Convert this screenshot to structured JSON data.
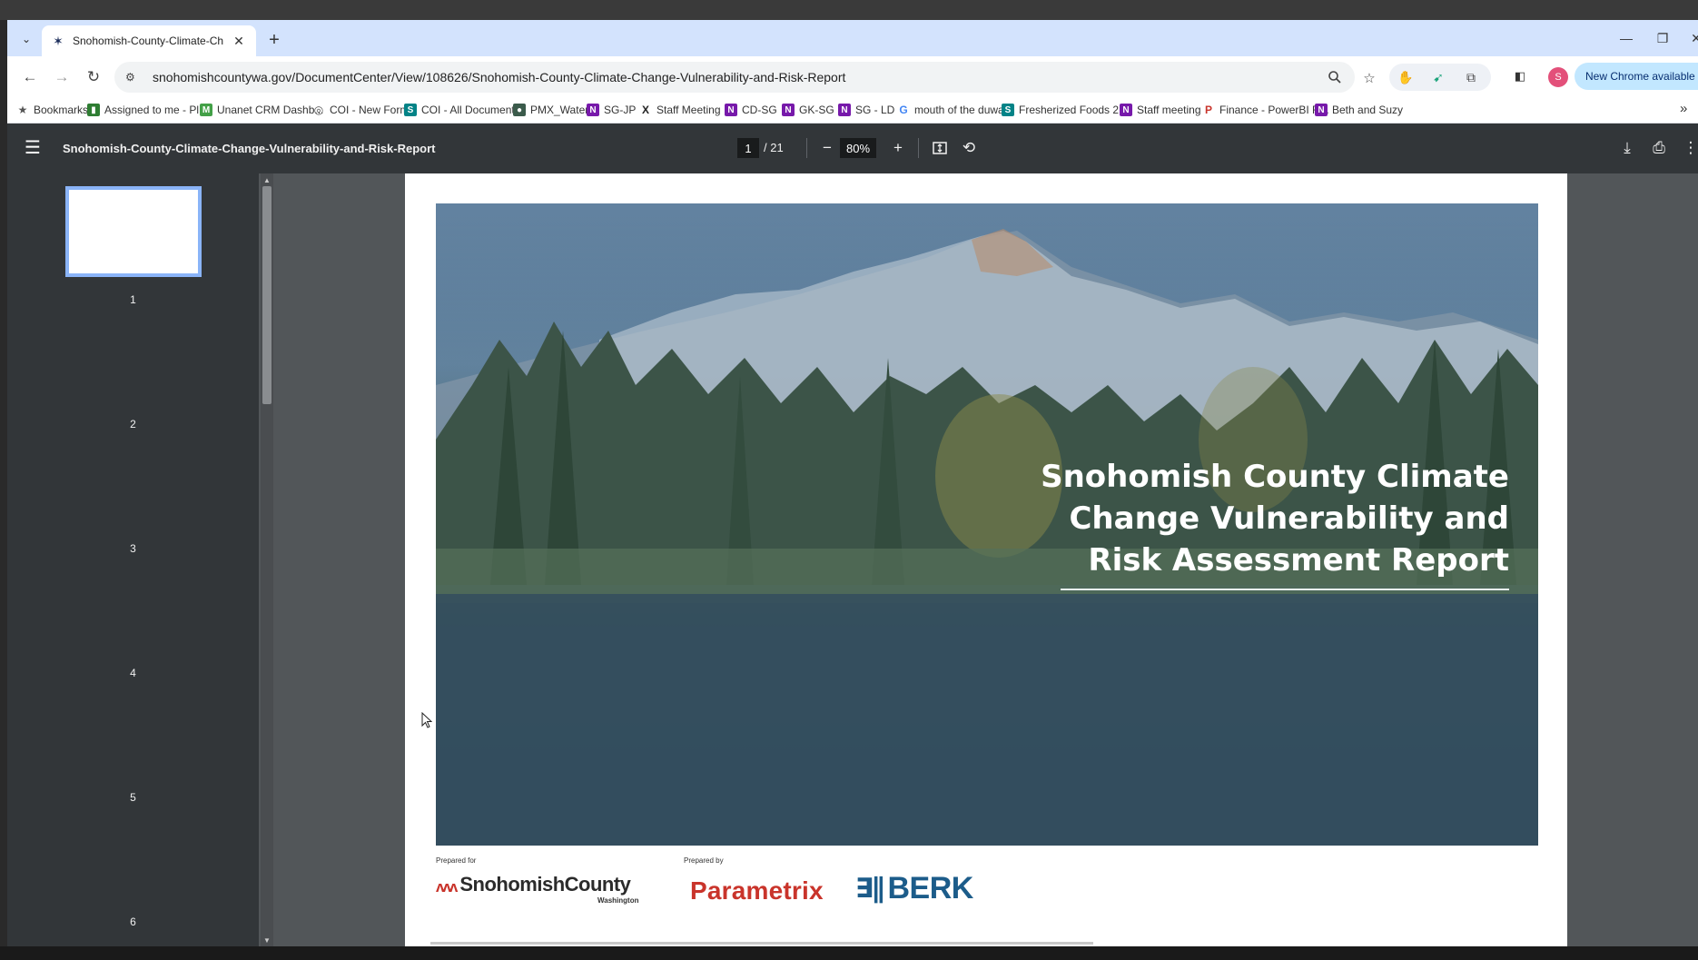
{
  "tab": {
    "title": "Snohomish-County-Climate-Ch",
    "close_glyph": "✕",
    "new_tab_glyph": "+"
  },
  "window_controls": {
    "minimize": "—",
    "restore": "❐",
    "close": "✕"
  },
  "toolbar": {
    "back": "←",
    "forward": "→",
    "reload": "↻",
    "url": "snohomishcountywa.gov/DocumentCenter/View/108626/Snohomish-County-Climate-Change-Vulnerability-and-Risk-Report",
    "update_label": "New Chrome available",
    "avatar_initial": "S"
  },
  "bookmarks": [
    {
      "label": "Bookmarks",
      "icon": "star-icon",
      "color": "#555555",
      "glyph": "★"
    },
    {
      "label": "Assigned to me - Pl...",
      "icon": "planner-icon",
      "color": "#2e7d32",
      "glyph": "▮"
    },
    {
      "label": "Unanet CRM Dashb...",
      "icon": "unanet-icon",
      "color": "#43a047",
      "glyph": "M"
    },
    {
      "label": "COI - New Form",
      "icon": "form-icon",
      "color": "#555555",
      "glyph": "◎"
    },
    {
      "label": "COI - All Documents",
      "icon": "sharepoint-icon",
      "color": "#038387",
      "glyph": "S"
    },
    {
      "label": "PMX_Water",
      "icon": "globe-icon",
      "color": "#3b5b4b",
      "glyph": "●"
    },
    {
      "label": "SG-JP",
      "icon": "onenote-icon",
      "color": "#7719aa",
      "glyph": "N"
    },
    {
      "label": "Staff Meeting",
      "icon": "x-icon",
      "color": "#222222",
      "glyph": "X"
    },
    {
      "label": "CD-SG",
      "icon": "onenote-icon",
      "color": "#7719aa",
      "glyph": "N"
    },
    {
      "label": "GK-SG",
      "icon": "onenote-icon",
      "color": "#7719aa",
      "glyph": "N"
    },
    {
      "label": "SG - LD",
      "icon": "onenote-icon",
      "color": "#7719aa",
      "glyph": "N"
    },
    {
      "label": "mouth of the duwa...",
      "icon": "google-icon",
      "color": "#4285f4",
      "glyph": "G"
    },
    {
      "label": "Fresherized Foods 2...",
      "icon": "sharepoint-icon",
      "color": "#038387",
      "glyph": "S"
    },
    {
      "label": "Staff meeting",
      "icon": "onenote-icon",
      "color": "#7719aa",
      "glyph": "N"
    },
    {
      "label": "Finance - PowerBI R...",
      "icon": "parametrix-icon",
      "color": "#c9342b",
      "glyph": "P"
    },
    {
      "label": "Beth and Suzy",
      "icon": "onenote-icon",
      "color": "#7719aa",
      "glyph": "N"
    }
  ],
  "bookmarks_overflow": "»",
  "pdf": {
    "title": "Snohomish-County-Climate-Change-Vulnerability-and-Risk-Report",
    "current_page": "1",
    "total_pages": "/ 21",
    "zoom": "80%",
    "thumbnails": [
      "1",
      "2",
      "3",
      "4",
      "5",
      "6"
    ]
  },
  "cover": {
    "title_line1": "Snohomish County Climate",
    "title_line2": "Change Vulnerability and",
    "title_line3": "Risk Assessment Report",
    "prepared_for": "Prepared for",
    "prepared_by": "Prepared by",
    "client_name": "SnohomishCounty",
    "client_sub": "Washington",
    "firm1": "Parametrix",
    "firm2": "BERK"
  },
  "colors": {
    "accent": "#8ab4f8",
    "pdf_toolbar": "#323639",
    "parametrix_red": "#c9342b",
    "berk_blue": "#1c5c8a"
  }
}
